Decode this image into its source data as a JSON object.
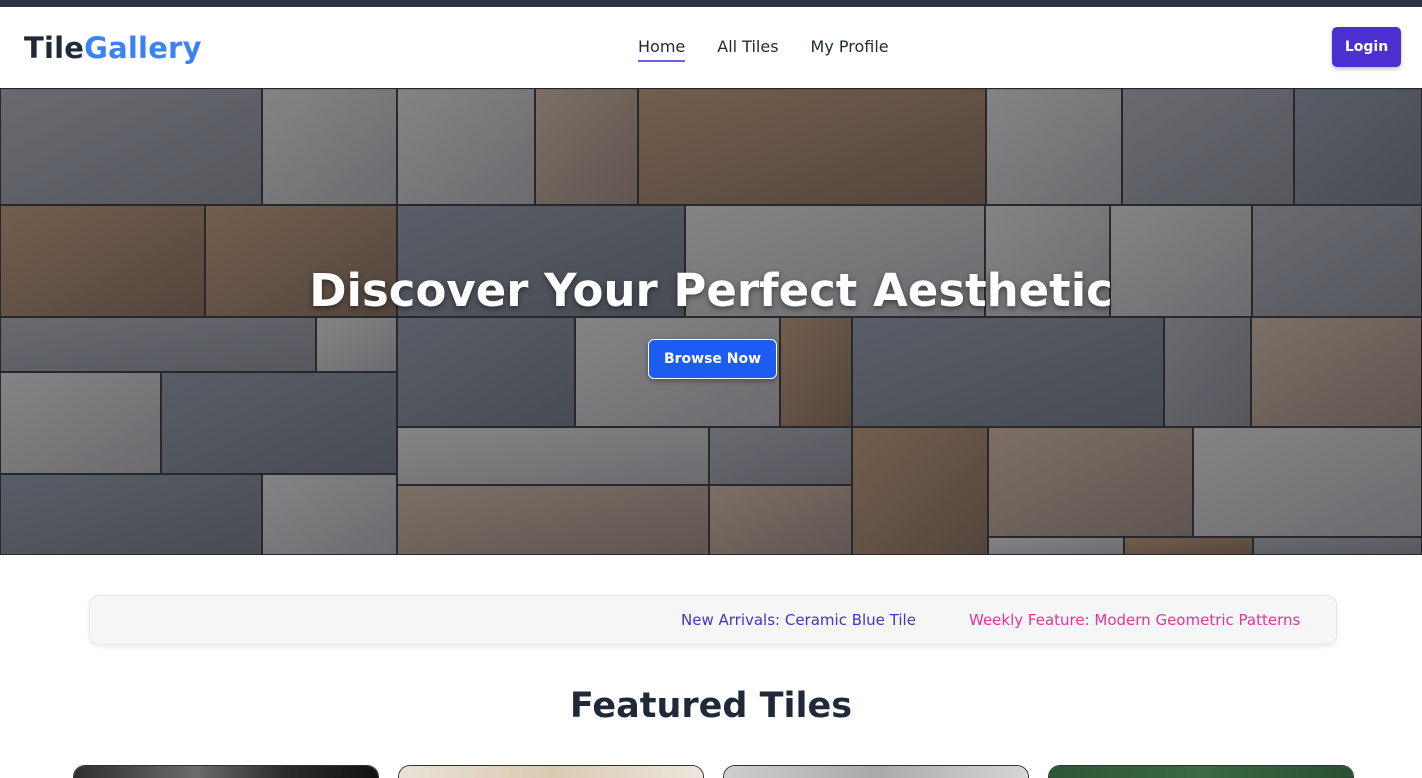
{
  "navbar": {
    "logo_part1": "Tile",
    "logo_part2": "Gallery",
    "links": [
      {
        "label": "Home",
        "active": true
      },
      {
        "label": "All Tiles",
        "active": false
      },
      {
        "label": "My Profile",
        "active": false
      }
    ],
    "login_label": "Login"
  },
  "hero": {
    "title": "Discover Your Perfect Aesthetic",
    "button_label": "Browse Now"
  },
  "ticker": {
    "items": [
      {
        "text": "New Arrivals: Ceramic Blue Tile",
        "color": "#4433c4"
      },
      {
        "text": "Weekly Feature: Modern Geometric Patterns",
        "color": "#e0359a"
      }
    ]
  },
  "featured": {
    "title": "Featured Tiles",
    "cards": [
      {
        "color": "#3a3a3a"
      },
      {
        "color": "#e7ded0"
      },
      {
        "color": "#c9c9c9"
      },
      {
        "color": "#2f5a35"
      }
    ]
  },
  "colors": {
    "brand_blue": "#3b82f6",
    "login_bg": "#4c2fd1",
    "browse_bg": "#1d5cf0",
    "active_underline": "#6d5ce8"
  }
}
